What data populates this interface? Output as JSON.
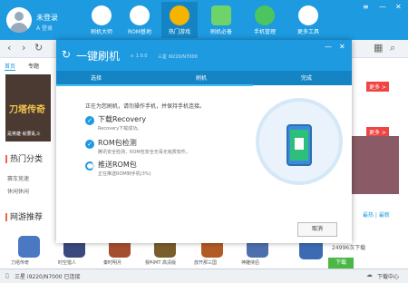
{
  "user": {
    "name": "未登录",
    "login": "A 登录"
  },
  "nav": [
    {
      "label": "刷机大师",
      "icon": "sync-icon"
    },
    {
      "label": "ROM基地",
      "icon": "rom-icon"
    },
    {
      "label": "热门游戏",
      "icon": "gamepad-icon"
    },
    {
      "label": "刷机必备",
      "icon": "apps-icon"
    },
    {
      "label": "手机管理",
      "icon": "shield-icon"
    },
    {
      "label": "更多工具",
      "icon": "tools-icon"
    }
  ],
  "sidebar": {
    "tabs": [
      "首页",
      "专题"
    ],
    "hero_title": "刀塔传奇",
    "hero_sub": "是英雄·就要乱斗",
    "hot_section": "热门分类",
    "categories": [
      "赛车竞速",
      "休闲休闲"
    ],
    "net_section": "网游推荐"
  },
  "right": {
    "more1": "更多 >",
    "more2": "更多 >",
    "links": "最热 | 最新",
    "count": "24996次下载",
    "download": "下载"
  },
  "games": [
    "刀塔传奇",
    "时空猎人",
    "秦时明月",
    "我叫MT 高清版",
    "放开那三国",
    "神雕侠侣"
  ],
  "status": {
    "device": "三星 i9220/N7000 已连接",
    "downloads": "下载中心"
  },
  "dialog": {
    "title": "一键刷机",
    "version": "v. 1.0.0",
    "device": "三星 i9220/N7000",
    "steps": [
      "选择",
      "刷机",
      "完成"
    ],
    "intro": "正在为您刷机，请勿操作手机，并保持手机连接。",
    "items": [
      {
        "title": "下载Recovery",
        "desc": "Recovery下载成功。"
      },
      {
        "title": "ROM包检测",
        "desc": "腾讯安全检测，ROM包安全无毒无吸费软件。"
      },
      {
        "title": "推送ROM包",
        "desc": "正在推送ROM到手机(3%)"
      }
    ],
    "cancel": "取消"
  }
}
